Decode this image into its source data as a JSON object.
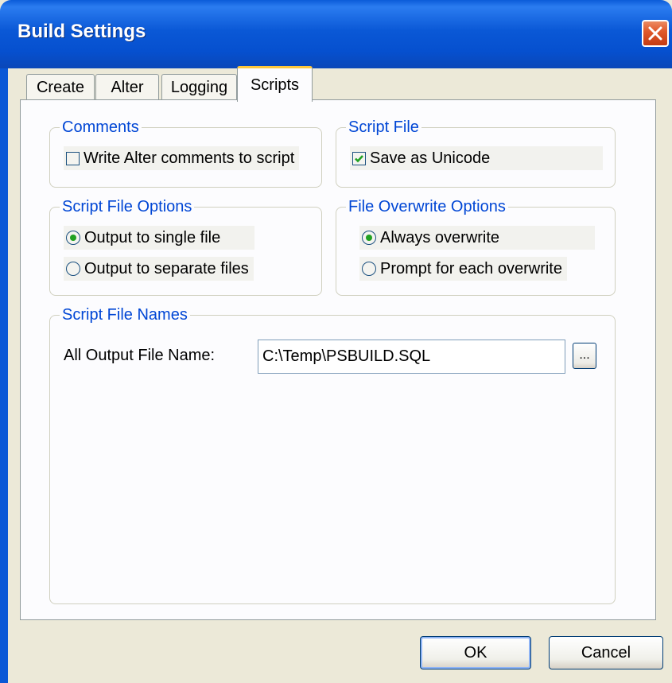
{
  "window": {
    "title": "Build Settings"
  },
  "tabs": [
    {
      "label": "Create"
    },
    {
      "label": "Alter"
    },
    {
      "label": "Logging"
    },
    {
      "label": "Scripts"
    }
  ],
  "active_tab": "Scripts",
  "comments": {
    "legend": "Comments",
    "write_alter_comments": {
      "label": "Write Alter comments to script",
      "checked": false
    }
  },
  "script_file": {
    "legend": "Script File",
    "save_as_unicode": {
      "label": "Save as Unicode",
      "checked": true
    }
  },
  "script_file_options": {
    "legend": "Script File Options",
    "options": [
      {
        "label": "Output to single file",
        "selected": true
      },
      {
        "label": "Output to separate files",
        "selected": false
      }
    ]
  },
  "file_overwrite_options": {
    "legend": "File Overwrite Options",
    "options": [
      {
        "label": "Always overwrite",
        "selected": true
      },
      {
        "label": "Prompt for each overwrite",
        "selected": false
      }
    ]
  },
  "script_file_names": {
    "legend": "Script File Names",
    "all_output_label": "All Output File Name:",
    "all_output_value": "C:\\Temp\\PSBUILD.SQL",
    "browse_label": "..."
  },
  "buttons": {
    "ok": "OK",
    "cancel": "Cancel"
  },
  "icons": {
    "close": "close-icon",
    "checkmark": "checkmark-icon"
  },
  "colors": {
    "titlebar": "#0a58d6",
    "group_label": "#0046d5",
    "close_button": "#e15a2c"
  }
}
